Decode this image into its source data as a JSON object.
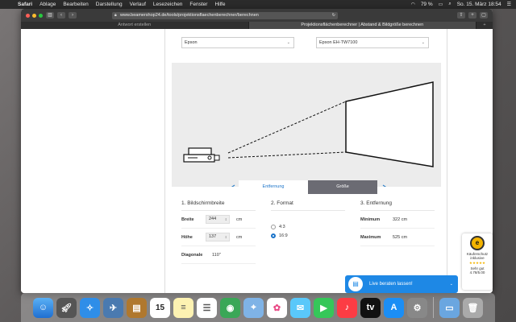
{
  "menubar": {
    "app": "Safari",
    "items": [
      "Ablage",
      "Bearbeiten",
      "Darstellung",
      "Verlauf",
      "Lesezeichen",
      "Fenster",
      "Hilfe"
    ],
    "battery": "79 %",
    "clock": "So. 15. März  18:54"
  },
  "browser": {
    "url": "www.beamershop24.de/tools/projektionsflaechenberechner/berechnen",
    "tabs": [
      {
        "label": "Antwort erstellen",
        "active": false
      },
      {
        "label": "Projektionsflächenberechner | Abstand & Bildgröße berechnen",
        "active": true
      }
    ]
  },
  "page": {
    "brand_select": "Epson",
    "model_select": "Epson EH-TW7100",
    "tabs": {
      "distance": "Entfernung",
      "size": "Größe"
    },
    "section1": {
      "title": "1. Bildschirmbreite",
      "width_label": "Breite",
      "width_value": "244",
      "height_label": "Höhe",
      "height_value": "137",
      "unit": "cm",
      "diagonal_label": "Diagonale",
      "diagonal_value": "110''"
    },
    "section2": {
      "title": "2. Format",
      "options": [
        "4:3",
        "16:9"
      ],
      "selected": "16:9"
    },
    "section3": {
      "title": "3. Entfernung",
      "min_label": "Minimum",
      "min_value": "322 cm",
      "max_label": "Maximum",
      "max_value": "525 cm"
    }
  },
  "badge": {
    "seal": "e",
    "title": "Käuferschutz",
    "subtitle": "inklusive",
    "rating_label": "Sehr gut",
    "rating_value": "4.78/5.00"
  },
  "chat": {
    "label": "Live beraten lassen!"
  },
  "colors": {
    "accent": "#1a73c9",
    "chat": "#1e88e5",
    "tab_inactive": "#6b6b73"
  },
  "dock": {
    "icons": [
      "finder-icon",
      "launchpad-icon",
      "safari-icon",
      "preview-icon",
      "contacts-icon",
      "calendar-icon",
      "notes-icon",
      "reminders-icon",
      "maps-icon",
      "photos-icon",
      "photos-app-icon",
      "messages-icon",
      "facetime-icon",
      "music-icon",
      "tv-icon",
      "appstore-icon",
      "system-preferences-icon",
      "downloads-icon",
      "trash-icon"
    ],
    "calendar_day": "15"
  }
}
